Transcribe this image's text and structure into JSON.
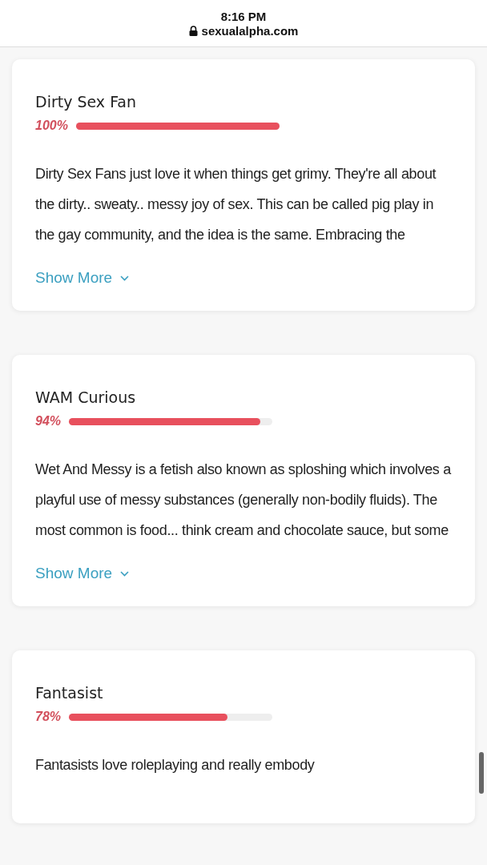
{
  "status_bar": {
    "time": "8:16 PM",
    "url": "sexualalpha.com"
  },
  "results": [
    {
      "title": "Dirty Sex Fan",
      "percent": "100%",
      "level": 1.0,
      "description": "Dirty Sex Fans just love it when things get grimy. They're all about the dirty.. sweaty.. messy joy of sex. This can be called pig play in the gay community, and the idea is the same. Embracing the",
      "more": "Show More"
    },
    {
      "title": "WAM Curious",
      "percent": "94%",
      "level": 0.94,
      "description": "Wet And Messy is a fetish also known as sploshing which involves a playful use of messy substances (generally non-bodily fluids). The most common is food... think cream and chocolate sauce, but some",
      "more": "Show More"
    },
    {
      "title": "Fantasist",
      "percent": "78%",
      "level": 0.78,
      "description": "Fantasists love roleplaying and really embody"
    }
  ]
}
